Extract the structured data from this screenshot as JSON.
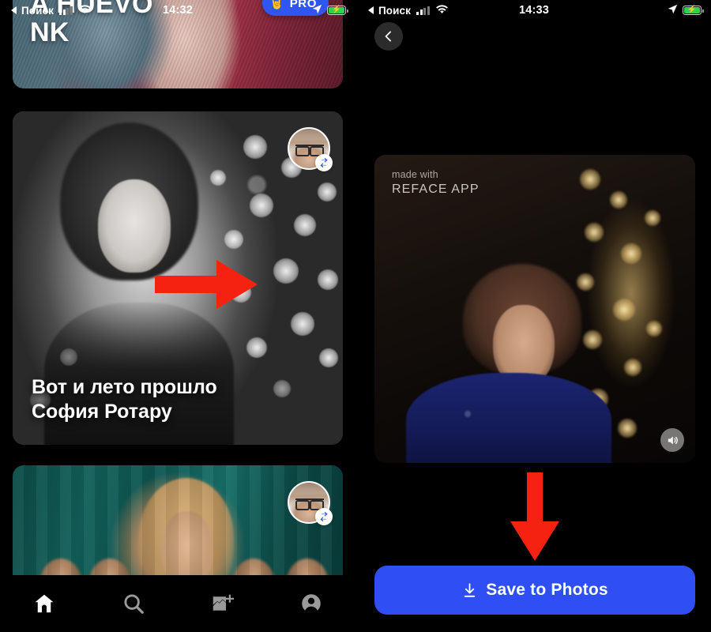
{
  "left_screen": {
    "status_bar": {
      "back_label": "Поиск",
      "time": "14:32",
      "signal_icon": "cellular-signal-icon",
      "wifi_icon": "wifi-icon",
      "location_icon": "location-arrow-icon",
      "battery_icon": "battery-charging-icon"
    },
    "cards": [
      {
        "title_line1": "A HUEVO",
        "title_line2": "NK",
        "badge_label": "PRO",
        "badge_emoji": "🤘"
      },
      {
        "caption_line1": "Вот и лето прошло",
        "caption_line2": "София Ротару",
        "avatar_name": "user-avatar",
        "swap_badge": "face-swap-badge"
      },
      {
        "avatar_name": "user-avatar",
        "swap_badge": "face-swap-badge"
      }
    ],
    "tab_bar": {
      "items": [
        {
          "name": "home",
          "icon": "home-icon",
          "active": true
        },
        {
          "name": "search",
          "icon": "search-icon",
          "active": false
        },
        {
          "name": "add-photo",
          "icon": "add-photo-icon",
          "active": false
        },
        {
          "name": "profile",
          "icon": "profile-icon",
          "active": false
        }
      ]
    },
    "annotation": {
      "arrow_right": "red-right-arrow",
      "color": "#f62211"
    }
  },
  "right_screen": {
    "status_bar": {
      "back_label": "Поиск",
      "time": "14:33",
      "signal_icon": "cellular-signal-icon",
      "wifi_icon": "wifi-icon",
      "location_icon": "location-arrow-icon",
      "battery_icon": "battery-charging-icon"
    },
    "back_button": {
      "icon": "chevron-left-icon"
    },
    "video": {
      "watermark_line1": "made with",
      "watermark_line2": "REFACE APP",
      "sound_icon": "speaker-on-icon"
    },
    "save_button": {
      "label": "Save to Photos",
      "icon": "download-icon",
      "color": "#2f4ff5"
    },
    "annotation": {
      "arrow_down": "red-down-arrow",
      "color": "#f62211"
    }
  }
}
